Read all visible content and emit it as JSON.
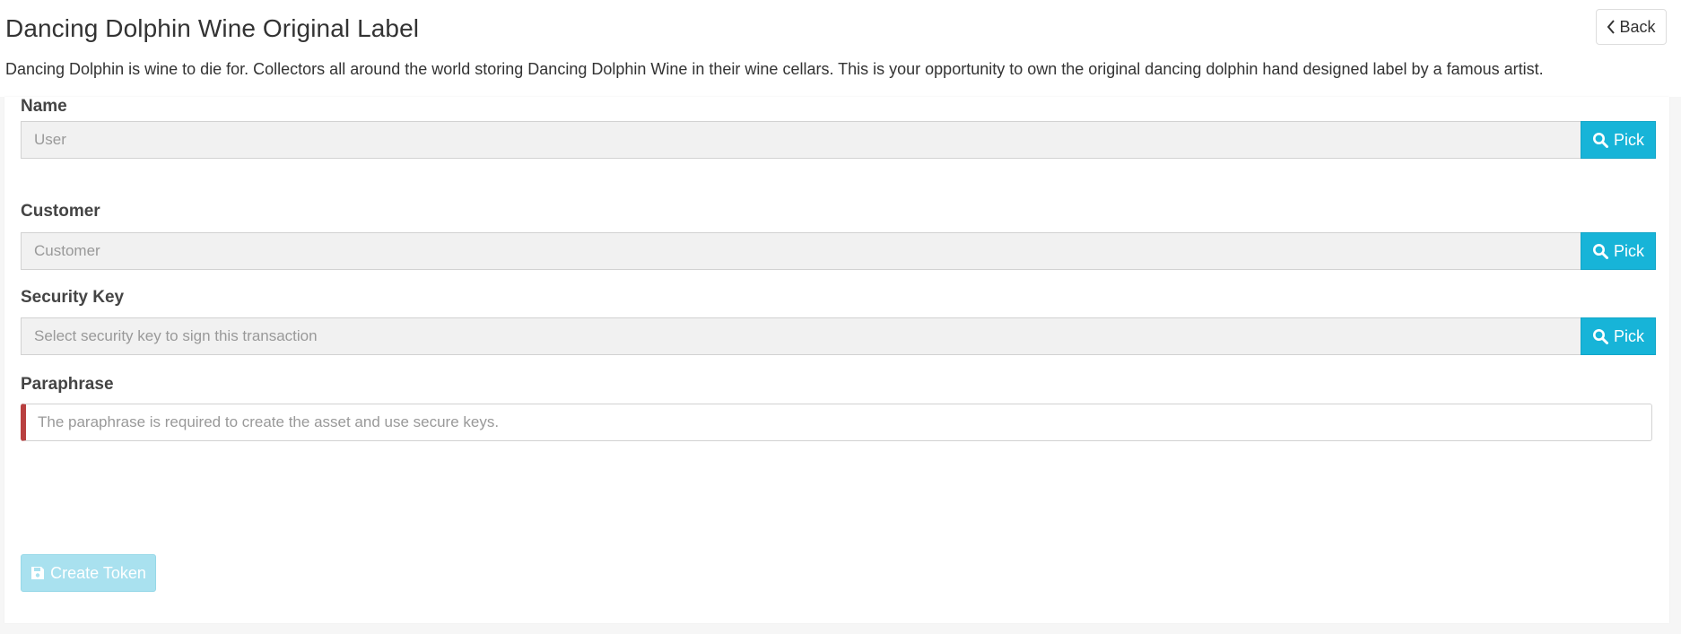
{
  "header": {
    "title": "Dancing Dolphin Wine Original Label",
    "description": "Dancing Dolphin is wine to die for. Collectors all around the world storing Dancing Dolphin Wine in their wine cellars. This is your opportunity to own the original dancing dolphin hand designed label by a famous artist.",
    "back_label": "Back"
  },
  "form": {
    "name": {
      "label": "Name",
      "placeholder": "User",
      "pick_label": "Pick"
    },
    "customer": {
      "label": "Customer",
      "placeholder": "Customer",
      "pick_label": "Pick"
    },
    "security_key": {
      "label": "Security Key",
      "placeholder": "Select security key to sign this transaction",
      "pick_label": "Pick"
    },
    "paraphrase": {
      "label": "Paraphrase",
      "placeholder": "The paraphrase is required to create the asset and use secure keys."
    },
    "submit_label": "Create Token"
  },
  "colors": {
    "accent": "#17b4d8",
    "error": "#b94040",
    "disabled_accent": "#a9e1ef"
  },
  "icons": {
    "back": "chevron-left-icon",
    "pick": "search-icon",
    "submit": "save-icon"
  }
}
